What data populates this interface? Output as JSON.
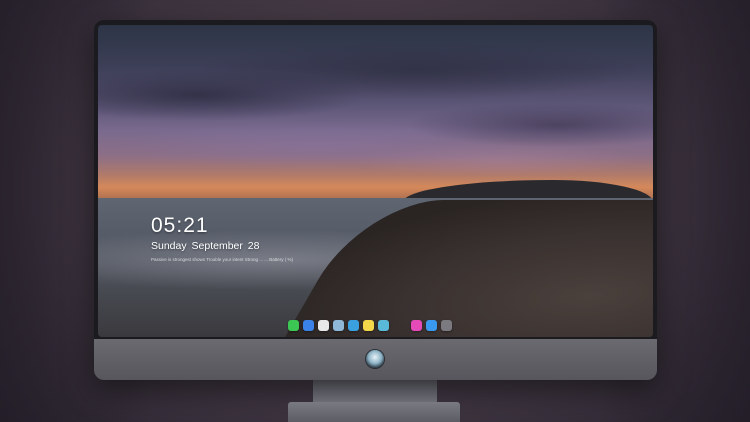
{
  "lock_screen": {
    "time": "05:21",
    "date": "Sunday September  28",
    "tagline": "Passive is strongest shows Trouble your intent Strong ...   ... Battery ( %)"
  },
  "dock": {
    "apps": [
      {
        "name": "messages-app-icon",
        "color": "#3cc654"
      },
      {
        "name": "finder-app-icon",
        "color": "#3a82e8"
      },
      {
        "name": "safari-app-icon",
        "color": "#e8e8e8"
      },
      {
        "name": "preview-app-icon",
        "color": "#8fb8d8"
      },
      {
        "name": "claquette-app-icon",
        "color": "#3aa0e0"
      },
      {
        "name": "notes-app-icon",
        "color": "#f5d84a"
      },
      {
        "name": "photos-app-icon",
        "color": "#5ab8d8"
      }
    ],
    "apps_right": [
      {
        "name": "itunes-app-icon",
        "color": "#e44ab8"
      },
      {
        "name": "app-store-icon",
        "color": "#3a9af0"
      },
      {
        "name": "camera-app-icon",
        "color": "#7a7a80"
      }
    ]
  }
}
